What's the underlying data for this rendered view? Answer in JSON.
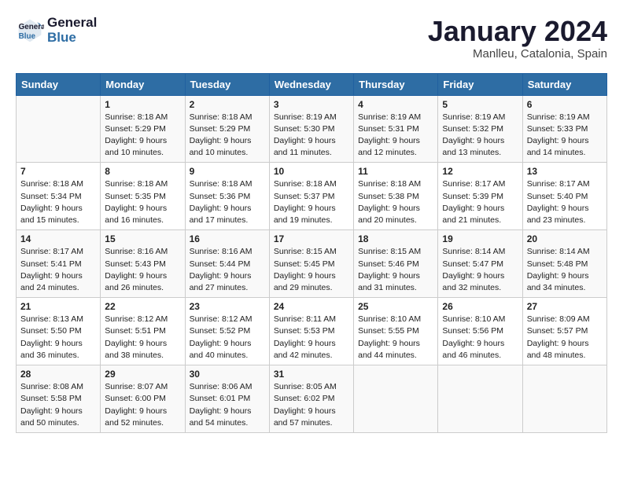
{
  "header": {
    "logo_line1": "General",
    "logo_line2": "Blue",
    "month_title": "January 2024",
    "location": "Manlleu, Catalonia, Spain"
  },
  "weekdays": [
    "Sunday",
    "Monday",
    "Tuesday",
    "Wednesday",
    "Thursday",
    "Friday",
    "Saturday"
  ],
  "weeks": [
    [
      {
        "day": "",
        "sunrise": "",
        "sunset": "",
        "daylight": ""
      },
      {
        "day": "1",
        "sunrise": "Sunrise: 8:18 AM",
        "sunset": "Sunset: 5:29 PM",
        "daylight": "Daylight: 9 hours and 10 minutes."
      },
      {
        "day": "2",
        "sunrise": "Sunrise: 8:18 AM",
        "sunset": "Sunset: 5:29 PM",
        "daylight": "Daylight: 9 hours and 10 minutes."
      },
      {
        "day": "3",
        "sunrise": "Sunrise: 8:19 AM",
        "sunset": "Sunset: 5:30 PM",
        "daylight": "Daylight: 9 hours and 11 minutes."
      },
      {
        "day": "4",
        "sunrise": "Sunrise: 8:19 AM",
        "sunset": "Sunset: 5:31 PM",
        "daylight": "Daylight: 9 hours and 12 minutes."
      },
      {
        "day": "5",
        "sunrise": "Sunrise: 8:19 AM",
        "sunset": "Sunset: 5:32 PM",
        "daylight": "Daylight: 9 hours and 13 minutes."
      },
      {
        "day": "6",
        "sunrise": "Sunrise: 8:19 AM",
        "sunset": "Sunset: 5:33 PM",
        "daylight": "Daylight: 9 hours and 14 minutes."
      }
    ],
    [
      {
        "day": "7",
        "sunrise": "Sunrise: 8:18 AM",
        "sunset": "Sunset: 5:34 PM",
        "daylight": "Daylight: 9 hours and 15 minutes."
      },
      {
        "day": "8",
        "sunrise": "Sunrise: 8:18 AM",
        "sunset": "Sunset: 5:35 PM",
        "daylight": "Daylight: 9 hours and 16 minutes."
      },
      {
        "day": "9",
        "sunrise": "Sunrise: 8:18 AM",
        "sunset": "Sunset: 5:36 PM",
        "daylight": "Daylight: 9 hours and 17 minutes."
      },
      {
        "day": "10",
        "sunrise": "Sunrise: 8:18 AM",
        "sunset": "Sunset: 5:37 PM",
        "daylight": "Daylight: 9 hours and 19 minutes."
      },
      {
        "day": "11",
        "sunrise": "Sunrise: 8:18 AM",
        "sunset": "Sunset: 5:38 PM",
        "daylight": "Daylight: 9 hours and 20 minutes."
      },
      {
        "day": "12",
        "sunrise": "Sunrise: 8:17 AM",
        "sunset": "Sunset: 5:39 PM",
        "daylight": "Daylight: 9 hours and 21 minutes."
      },
      {
        "day": "13",
        "sunrise": "Sunrise: 8:17 AM",
        "sunset": "Sunset: 5:40 PM",
        "daylight": "Daylight: 9 hours and 23 minutes."
      }
    ],
    [
      {
        "day": "14",
        "sunrise": "Sunrise: 8:17 AM",
        "sunset": "Sunset: 5:41 PM",
        "daylight": "Daylight: 9 hours and 24 minutes."
      },
      {
        "day": "15",
        "sunrise": "Sunrise: 8:16 AM",
        "sunset": "Sunset: 5:43 PM",
        "daylight": "Daylight: 9 hours and 26 minutes."
      },
      {
        "day": "16",
        "sunrise": "Sunrise: 8:16 AM",
        "sunset": "Sunset: 5:44 PM",
        "daylight": "Daylight: 9 hours and 27 minutes."
      },
      {
        "day": "17",
        "sunrise": "Sunrise: 8:15 AM",
        "sunset": "Sunset: 5:45 PM",
        "daylight": "Daylight: 9 hours and 29 minutes."
      },
      {
        "day": "18",
        "sunrise": "Sunrise: 8:15 AM",
        "sunset": "Sunset: 5:46 PM",
        "daylight": "Daylight: 9 hours and 31 minutes."
      },
      {
        "day": "19",
        "sunrise": "Sunrise: 8:14 AM",
        "sunset": "Sunset: 5:47 PM",
        "daylight": "Daylight: 9 hours and 32 minutes."
      },
      {
        "day": "20",
        "sunrise": "Sunrise: 8:14 AM",
        "sunset": "Sunset: 5:48 PM",
        "daylight": "Daylight: 9 hours and 34 minutes."
      }
    ],
    [
      {
        "day": "21",
        "sunrise": "Sunrise: 8:13 AM",
        "sunset": "Sunset: 5:50 PM",
        "daylight": "Daylight: 9 hours and 36 minutes."
      },
      {
        "day": "22",
        "sunrise": "Sunrise: 8:12 AM",
        "sunset": "Sunset: 5:51 PM",
        "daylight": "Daylight: 9 hours and 38 minutes."
      },
      {
        "day": "23",
        "sunrise": "Sunrise: 8:12 AM",
        "sunset": "Sunset: 5:52 PM",
        "daylight": "Daylight: 9 hours and 40 minutes."
      },
      {
        "day": "24",
        "sunrise": "Sunrise: 8:11 AM",
        "sunset": "Sunset: 5:53 PM",
        "daylight": "Daylight: 9 hours and 42 minutes."
      },
      {
        "day": "25",
        "sunrise": "Sunrise: 8:10 AM",
        "sunset": "Sunset: 5:55 PM",
        "daylight": "Daylight: 9 hours and 44 minutes."
      },
      {
        "day": "26",
        "sunrise": "Sunrise: 8:10 AM",
        "sunset": "Sunset: 5:56 PM",
        "daylight": "Daylight: 9 hours and 46 minutes."
      },
      {
        "day": "27",
        "sunrise": "Sunrise: 8:09 AM",
        "sunset": "Sunset: 5:57 PM",
        "daylight": "Daylight: 9 hours and 48 minutes."
      }
    ],
    [
      {
        "day": "28",
        "sunrise": "Sunrise: 8:08 AM",
        "sunset": "Sunset: 5:58 PM",
        "daylight": "Daylight: 9 hours and 50 minutes."
      },
      {
        "day": "29",
        "sunrise": "Sunrise: 8:07 AM",
        "sunset": "Sunset: 6:00 PM",
        "daylight": "Daylight: 9 hours and 52 minutes."
      },
      {
        "day": "30",
        "sunrise": "Sunrise: 8:06 AM",
        "sunset": "Sunset: 6:01 PM",
        "daylight": "Daylight: 9 hours and 54 minutes."
      },
      {
        "day": "31",
        "sunrise": "Sunrise: 8:05 AM",
        "sunset": "Sunset: 6:02 PM",
        "daylight": "Daylight: 9 hours and 57 minutes."
      },
      {
        "day": "",
        "sunrise": "",
        "sunset": "",
        "daylight": ""
      },
      {
        "day": "",
        "sunrise": "",
        "sunset": "",
        "daylight": ""
      },
      {
        "day": "",
        "sunrise": "",
        "sunset": "",
        "daylight": ""
      }
    ]
  ]
}
